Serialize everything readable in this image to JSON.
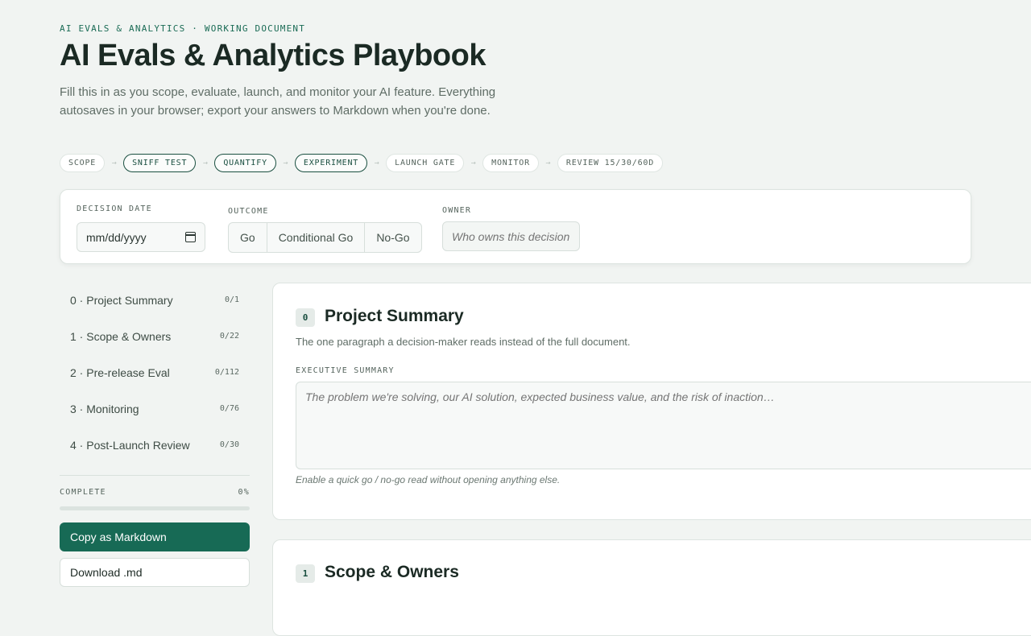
{
  "header": {
    "eyebrow": "AI EVALS & ANALYTICS · WORKING DOCUMENT",
    "title": "AI Evals & Analytics Playbook",
    "intro": "Fill this in as you scope, evaluate, launch, and monitor your AI feature. Everything autosaves in your browser; export your answers to Markdown when you're done."
  },
  "steps": [
    {
      "label": "SCOPE",
      "active": false
    },
    {
      "label": "SNIFF TEST",
      "active": true
    },
    {
      "label": "QUANTIFY",
      "active": true
    },
    {
      "label": "EXPERIMENT",
      "active": true
    },
    {
      "label": "LAUNCH GATE",
      "active": false
    },
    {
      "label": "MONITOR",
      "active": false
    },
    {
      "label": "REVIEW 15/30/60D",
      "active": false
    }
  ],
  "decision": {
    "date_label": "DECISION DATE",
    "date_value": "mm/dd/yyyy",
    "outcome_label": "OUTCOME",
    "outcome_options": [
      "Go",
      "Conditional Go",
      "No-Go"
    ],
    "owner_label": "OWNER",
    "owner_placeholder": "Who owns this decision"
  },
  "nav": {
    "items": [
      {
        "label": "0 · Project Summary",
        "count": "0/1"
      },
      {
        "label": "1 · Scope & Owners",
        "count": "0/22"
      },
      {
        "label": "2 · Pre-release Eval",
        "count": "0/112"
      },
      {
        "label": "3 · Monitoring",
        "count": "0/76"
      },
      {
        "label": "4 · Post-Launch Review",
        "count": "0/30"
      }
    ],
    "complete_label": "COMPLETE",
    "complete_value": "0%",
    "progress": 0,
    "copy_button": "Copy as Markdown",
    "download_button": "Download .md"
  },
  "sections": [
    {
      "number": "0",
      "title": "Project Summary",
      "description": "The one paragraph a decision-maker reads instead of the full document.",
      "field_label": "EXECUTIVE SUMMARY",
      "field_placeholder": "The problem we're solving, our AI solution, expected business value, and the risk of inaction…",
      "hint": "Enable a quick go / no-go read without opening anything else."
    },
    {
      "number": "1",
      "title": "Scope & Owners"
    }
  ],
  "colors": {
    "accent": "#176a55",
    "background": "#f1f4f2",
    "active_step_border": "#1a4f40"
  }
}
